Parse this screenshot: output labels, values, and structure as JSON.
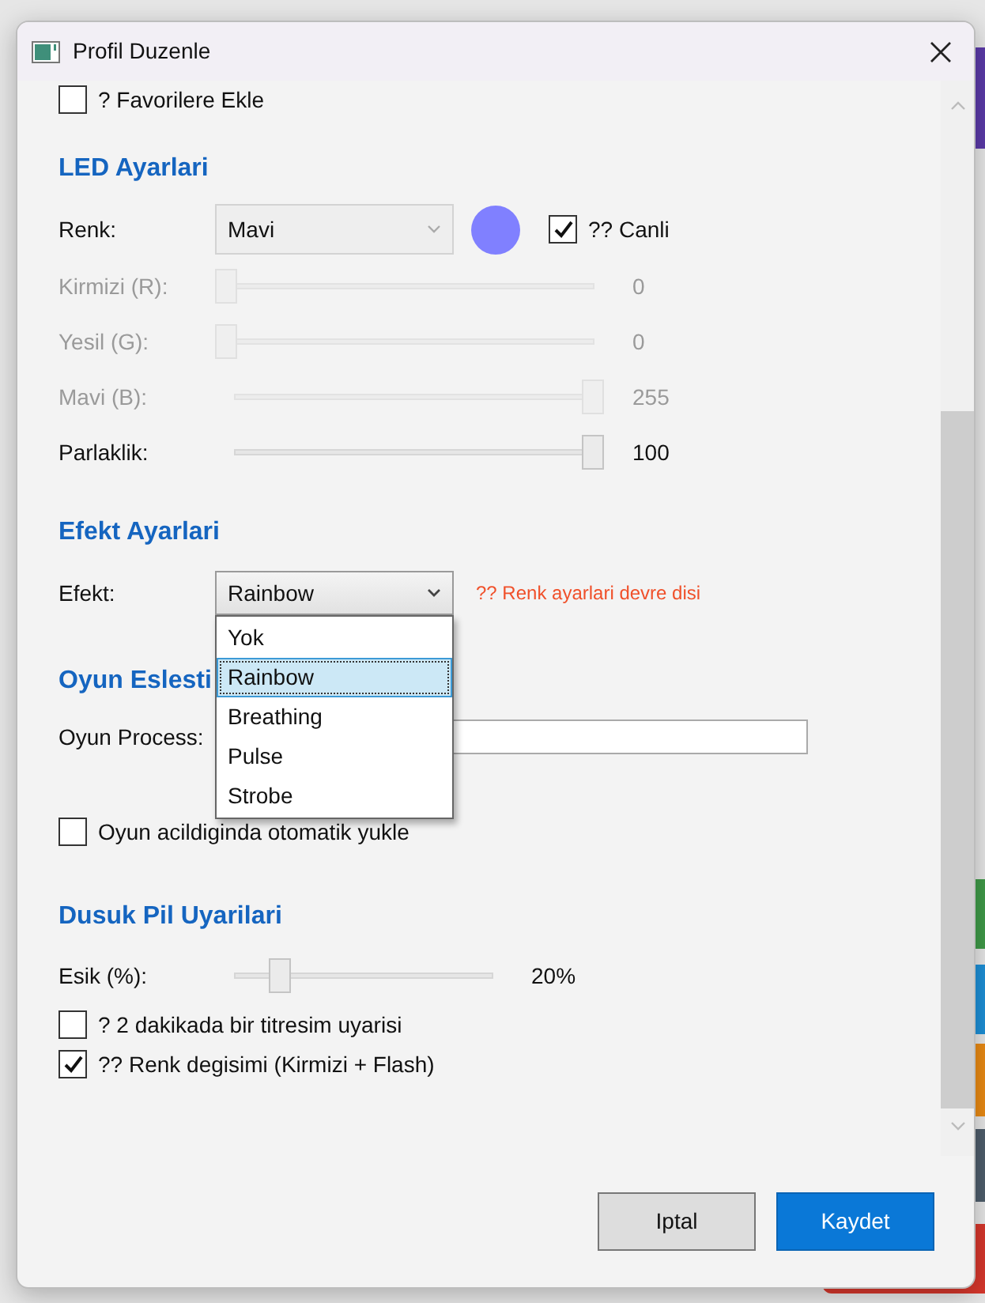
{
  "window": {
    "title": "Profil Duzenle"
  },
  "favorite": {
    "label": "? Favorilere Ekle",
    "checked": false
  },
  "led": {
    "heading": "LED Ayarlari",
    "color_label": "Renk:",
    "color_value": "Mavi",
    "swatch": {
      "color": "#8080ff"
    },
    "live": {
      "label": "?? Canli",
      "checked": true
    },
    "sliders": [
      {
        "label": "Kirmizi (R):",
        "level": 0,
        "reading": "0",
        "disabled": true
      },
      {
        "label": "Yesil (G):",
        "level": 0,
        "reading": "0",
        "disabled": true
      },
      {
        "label": "Mavi (B):",
        "level": 1,
        "reading": "255",
        "disabled": true
      },
      {
        "label": "Parlaklik:",
        "level": 1,
        "reading": "100",
        "disabled": false
      }
    ]
  },
  "effect": {
    "heading": "Efekt Ayarlari",
    "label": "Efekt:",
    "value": "Rainbow",
    "expanded": true,
    "warning": "?? Renk ayarlari devre disi",
    "options": [
      {
        "label": "Yok",
        "selected": false
      },
      {
        "label": "Rainbow",
        "selected": true
      },
      {
        "label": "Breathing",
        "selected": false
      },
      {
        "label": "Pulse",
        "selected": false
      },
      {
        "label": "Strobe",
        "selected": false
      }
    ]
  },
  "game": {
    "heading": "Oyun Eslesti",
    "process_label": "Oyun Process:",
    "auto_load": {
      "label": "Oyun acildiginda otomatik yukle",
      "checked": false
    }
  },
  "battery": {
    "heading": "Dusuk Pil Uyarilari",
    "threshold": {
      "label": "Esik (%):",
      "level": 0.17,
      "reading": "20%"
    },
    "options": [
      {
        "label": "? 2 dakikada bir titresim uyarisi",
        "checked": false
      },
      {
        "label": "?? Renk degisimi (Kirmizi + Flash)",
        "checked": true
      }
    ]
  },
  "buttons": [
    {
      "label": "Iptal",
      "kind": "secondary"
    },
    {
      "label": "Kaydet",
      "kind": "primary"
    }
  ]
}
